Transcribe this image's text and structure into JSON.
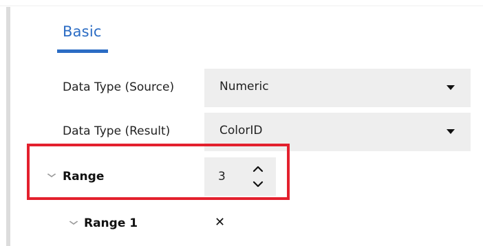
{
  "tabs": {
    "basic_label": "Basic"
  },
  "properties": {
    "source": {
      "label": "Data Type (Source)",
      "value": "Numeric"
    },
    "result": {
      "label": "Data Type (Result)",
      "value": "ColorID"
    },
    "range": {
      "label": "Range",
      "value": "3"
    },
    "range1": {
      "label": "Range 1",
      "remove_glyph": "✕"
    }
  },
  "icons": {
    "expand": "chevron-down-icon",
    "dropdown": "caret-down-icon",
    "up": "chevron-up-icon",
    "down": "chevron-down-icon",
    "remove": "close-icon"
  },
  "colors": {
    "accent": "#2b6cc4",
    "highlight": "#e3202d",
    "field_bg": "#eeeeee"
  }
}
